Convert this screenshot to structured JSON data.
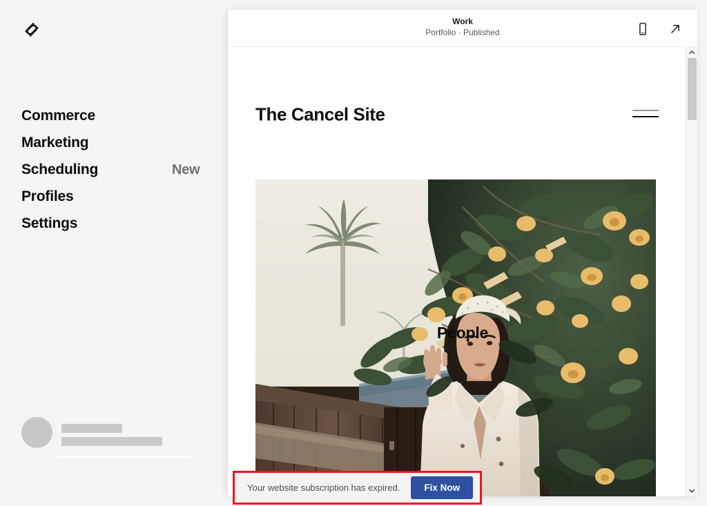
{
  "app": {
    "brand_logo_icon": "squarespace-logo-icon",
    "background_color": "#f5f5f5"
  },
  "sidebar": {
    "items": [
      {
        "label": "Commerce",
        "badge": ""
      },
      {
        "label": "Marketing",
        "badge": ""
      },
      {
        "label": "Scheduling",
        "badge": "New"
      },
      {
        "label": "Profiles",
        "badge": ""
      },
      {
        "label": "Settings",
        "badge": ""
      }
    ],
    "account": {
      "avatar_icon": "user-avatar-placeholder",
      "name_placeholder": "",
      "email_placeholder": ""
    }
  },
  "preview_panel": {
    "header": {
      "title": "Work",
      "subtitle": "Portfolio · Published",
      "mobile_view_icon": "mobile-device-icon",
      "open_external_icon": "external-link-arrow-icon"
    },
    "site": {
      "title": "The Cancel Site",
      "menu_icon": "hamburger-menu-icon",
      "hero_caption": "People",
      "hero_image_alt": "Woman in cream coat and white headscarf beside wooden fence with flowering vine"
    },
    "scrollbar": {
      "up_arrow_icon": "chevron-up-icon",
      "down_arrow_icon": "chevron-down-icon",
      "thumb_position_percent": 2
    }
  },
  "notification": {
    "message": "Your website subscription has expired.",
    "action_label": "Fix Now",
    "action_color": "#2d50a3",
    "highlight_color": "#fc0d1b"
  }
}
